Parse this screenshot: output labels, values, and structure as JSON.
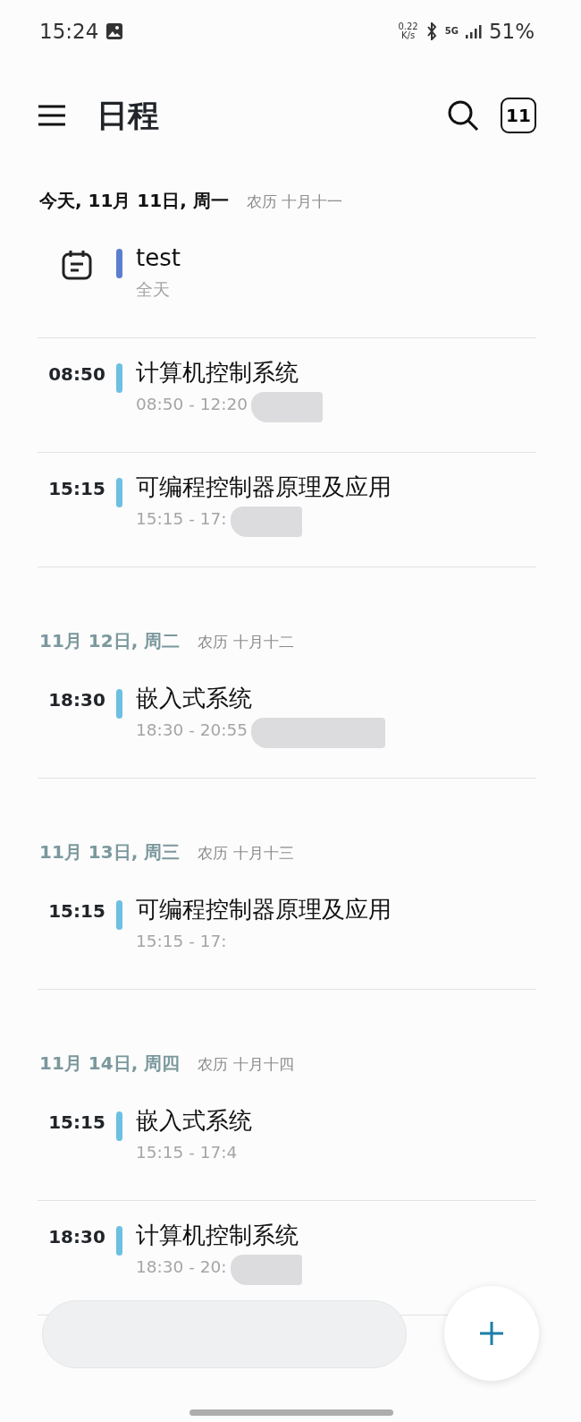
{
  "status_bar": {
    "time": "15:24",
    "net_speed": "0.22",
    "net_unit": "K/s",
    "network": "5G",
    "battery": "51%"
  },
  "header": {
    "title": "日程",
    "today_badge": "11"
  },
  "days": [
    {
      "date": "今天, 11月 11日, 周一",
      "lunar": "农历 十月十一",
      "today": true,
      "events": [
        {
          "kind": "allday",
          "title": "test",
          "range": "全天",
          "color": "#5b7fcf",
          "redacted": false
        },
        {
          "kind": "timed",
          "time": "08:50",
          "title": "计算机控制系统",
          "range": "08:50 - 12:20",
          "color": "#6cc0e2",
          "redacted": true
        },
        {
          "kind": "timed",
          "time": "15:15",
          "title": "可编程控制器原理及应用",
          "range": "15:15 - 17:",
          "color": "#6cc0e2",
          "redacted": true
        }
      ]
    },
    {
      "date": "11月 12日, 周二",
      "lunar": "农历 十月十二",
      "today": false,
      "events": [
        {
          "kind": "timed",
          "time": "18:30",
          "title": "嵌入式系统",
          "range": "18:30 - 20:55",
          "color": "#6cc0e2",
          "redacted": true
        }
      ]
    },
    {
      "date": "11月 13日, 周三",
      "lunar": "农历 十月十三",
      "today": false,
      "events": [
        {
          "kind": "timed",
          "time": "15:15",
          "title": "可编程控制器原理及应用",
          "range": "15:15 - 17:",
          "color": "#6cc0e2",
          "redacted": false
        }
      ]
    },
    {
      "date": "11月 14日, 周四",
      "lunar": "农历 十月十四",
      "today": false,
      "events": [
        {
          "kind": "timed",
          "time": "15:15",
          "title": "嵌入式系统",
          "range": "15:15 - 17:4",
          "color": "#6cc0e2",
          "redacted": false
        },
        {
          "kind": "timed",
          "time": "18:30",
          "title": "计算机控制系统",
          "range": "18:30 - 20:",
          "color": "#6cc0e2",
          "redacted": true
        }
      ]
    }
  ]
}
